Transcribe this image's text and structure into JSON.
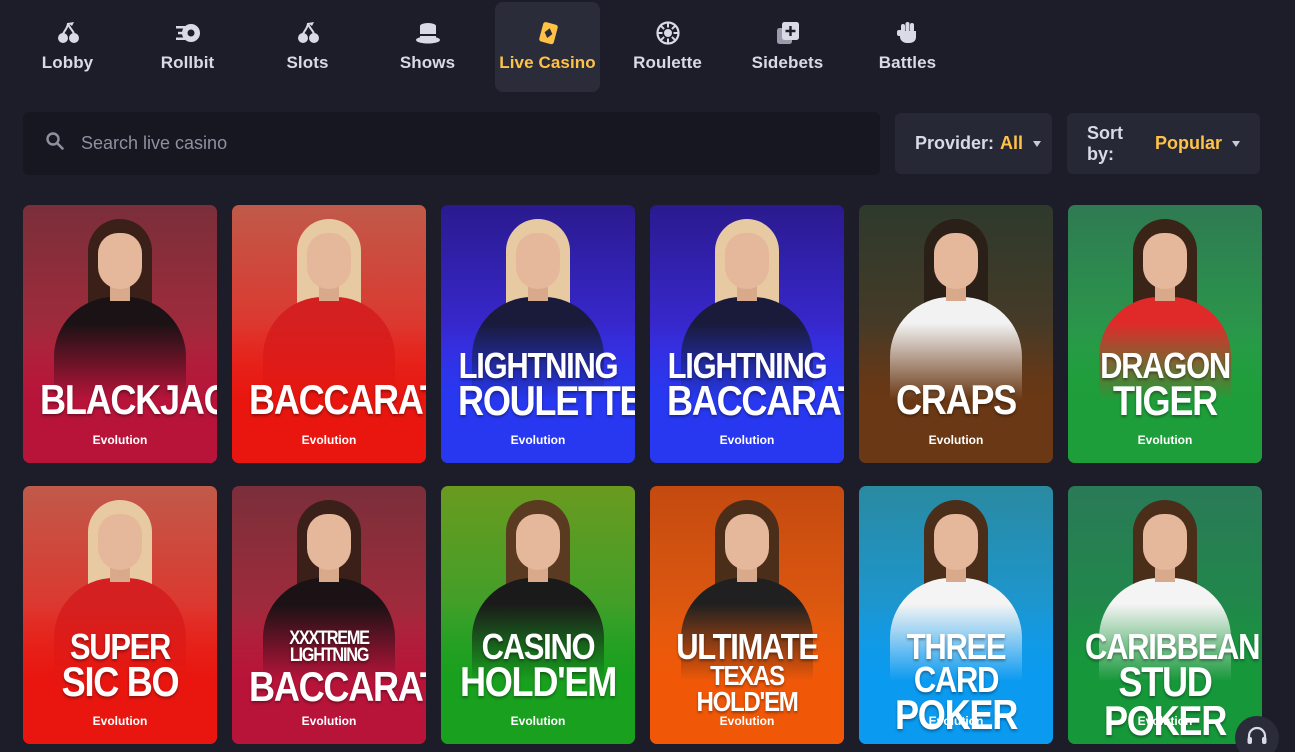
{
  "nav": {
    "items": [
      {
        "label": "Lobby",
        "icon": "cherries-icon",
        "active": false
      },
      {
        "label": "Rollbit",
        "icon": "rollbit-logo-icon",
        "active": false
      },
      {
        "label": "Slots",
        "icon": "cherries-icon",
        "active": false
      },
      {
        "label": "Shows",
        "icon": "top-hat-icon",
        "active": false
      },
      {
        "label": "Live Casino",
        "icon": "playing-card-icon",
        "active": true
      },
      {
        "label": "Roulette",
        "icon": "roulette-wheel-icon",
        "active": false
      },
      {
        "label": "Sidebets",
        "icon": "plus-cards-icon",
        "active": false
      },
      {
        "label": "Battles",
        "icon": "fist-icon",
        "active": false
      }
    ]
  },
  "search": {
    "placeholder": "Search live casino",
    "value": ""
  },
  "filters": {
    "provider_label": "Provider:",
    "provider_value": "All",
    "sort_label": "Sort by:",
    "sort_value": "Popular"
  },
  "colors": {
    "accent": "#ffc247",
    "background": "#1c1d29",
    "panel": "#262836"
  },
  "games": [
    {
      "line1": "Blackjack",
      "line2": "",
      "provider": "Evolution",
      "theme": "crimson"
    },
    {
      "line1": "Baccarat",
      "line2": "",
      "provider": "Evolution",
      "theme": "red"
    },
    {
      "line1": "Lightning",
      "line2": "Roulette",
      "provider": "Evolution",
      "theme": "blue"
    },
    {
      "line1": "Lightning",
      "line2": "Baccarat",
      "provider": "Evolution",
      "theme": "blue"
    },
    {
      "line1": "Craps",
      "line2": "",
      "provider": "Evolution",
      "theme": "brown"
    },
    {
      "line1": "Dragon",
      "line2": "Tiger",
      "provider": "Evolution",
      "theme": "green"
    },
    {
      "line1": "Super",
      "line2": "Sic Bo",
      "provider": "Evolution",
      "theme": "red"
    },
    {
      "line1": "XXXtreme Lightning",
      "line2": "Baccarat",
      "provider": "Evolution",
      "theme": "crimson"
    },
    {
      "line1": "Casino",
      "line2": "Hold'em",
      "provider": "Evolution",
      "theme": "lime"
    },
    {
      "line1": "Ultimate",
      "line2": "Texas Hold'em",
      "provider": "Evolution",
      "theme": "orange"
    },
    {
      "line1": "Three Card",
      "line2": "Poker",
      "provider": "Evolution",
      "theme": "sky"
    },
    {
      "line1": "Caribbean",
      "line2": "Stud Poker",
      "provider": "Evolution",
      "theme": "emerald"
    }
  ],
  "support_icon": "headset-icon"
}
